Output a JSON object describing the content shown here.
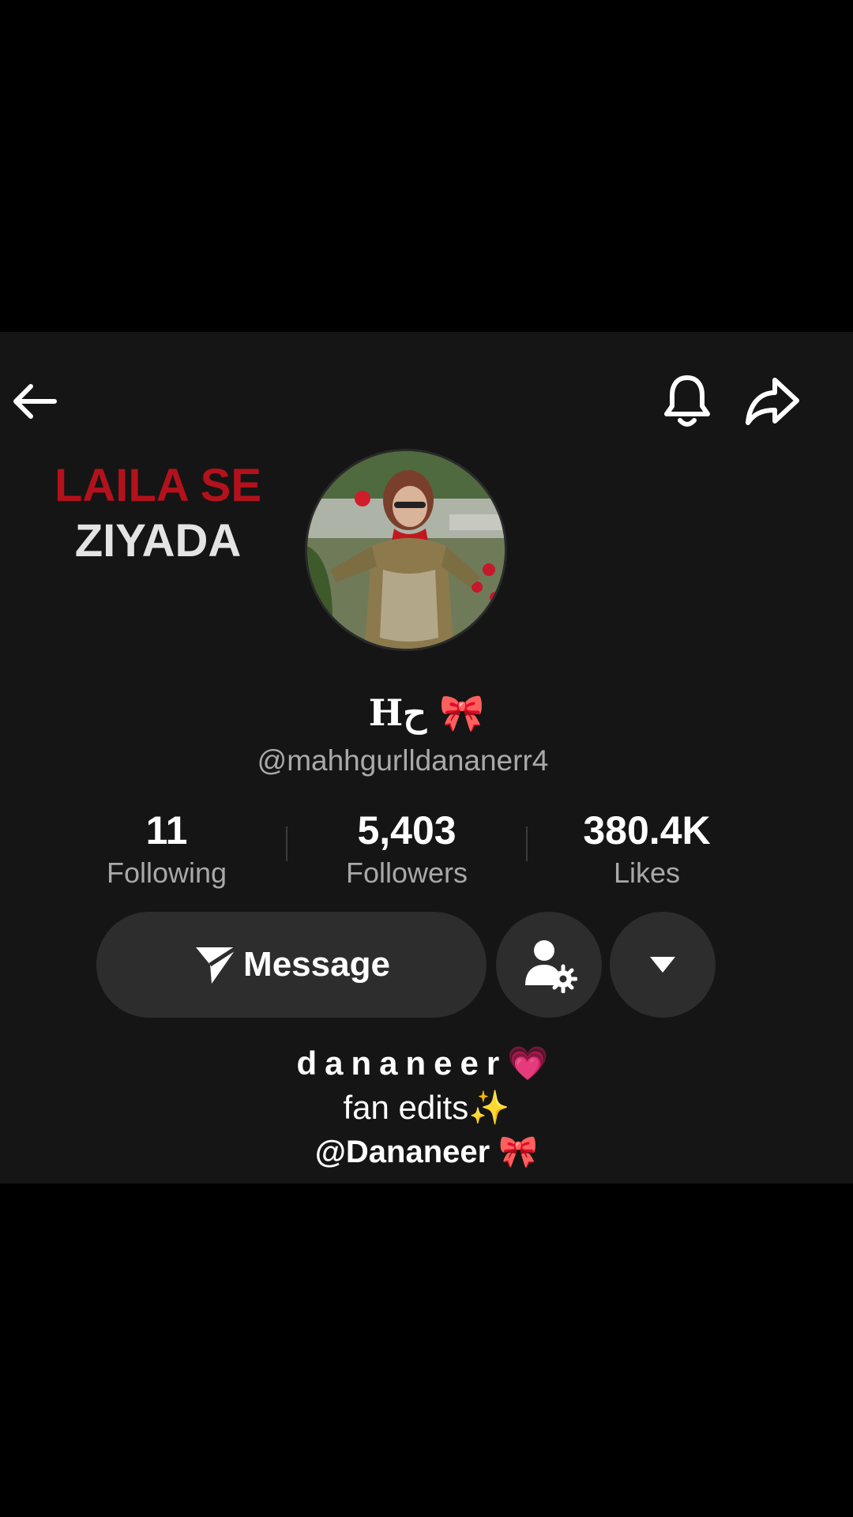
{
  "overlay": {
    "line1": "LAILA SE",
    "line2": "ZIYADA"
  },
  "profile": {
    "display_name": "Hح 🎀",
    "username": "@mahhgurlldananerr4"
  },
  "stats": [
    {
      "value": "11",
      "label": "Following"
    },
    {
      "value": "5,403",
      "label": "Followers"
    },
    {
      "value": "380.4K",
      "label": "Likes"
    }
  ],
  "actions": {
    "message_label": "Message"
  },
  "bio": {
    "line1": "dananeer💗",
    "line2": "fan edits✨",
    "line3": "@Dananeer 🎀"
  },
  "icons": {
    "back": "arrow-left-icon",
    "notifications": "bell-icon",
    "share": "share-arrow-icon",
    "message": "paper-plane-icon",
    "friend_settings": "user-settings-icon",
    "more": "caret-down-icon"
  },
  "colors": {
    "panel_background": "#151515",
    "button_background": "#2d2d2d",
    "overlay_red": "#b3121c",
    "secondary_text": "#a8a8a8"
  }
}
